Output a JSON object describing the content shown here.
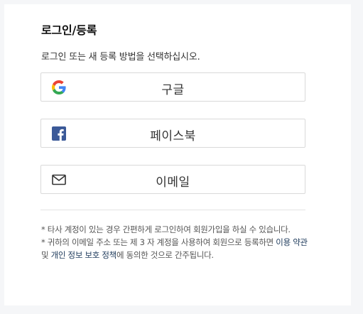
{
  "login": {
    "title": "로그인/등록",
    "subtitle": "로그인 또는 새 등록 방법을 선택하십시오.",
    "buttons": [
      {
        "label": "구글",
        "icon": "google-icon"
      },
      {
        "label": "페이스북",
        "icon": "facebook-icon"
      },
      {
        "label": "이메일",
        "icon": "envelope-icon"
      }
    ],
    "notes": {
      "note1": "* 타사 계정이 있는 경우 간편하게 로그인하여 회원가입을 하실 수 있습니다.",
      "note2_prefix": "* 귀하의 이메일 주소 또는 제 3 자 계정을 사용하여 회원으로 등록하면 ",
      "terms_link": "이용 약관",
      "and_text": " 및 ",
      "privacy_link": "개인 정보 보호 정책",
      "note2_suffix": "에 동의한 것으로 간주됩니다."
    }
  },
  "colors": {
    "background": "#f5f6f8",
    "card": "#ffffff",
    "border": "#d9d9d9",
    "link": "#1f3b5c",
    "facebook": "#3b5998"
  }
}
